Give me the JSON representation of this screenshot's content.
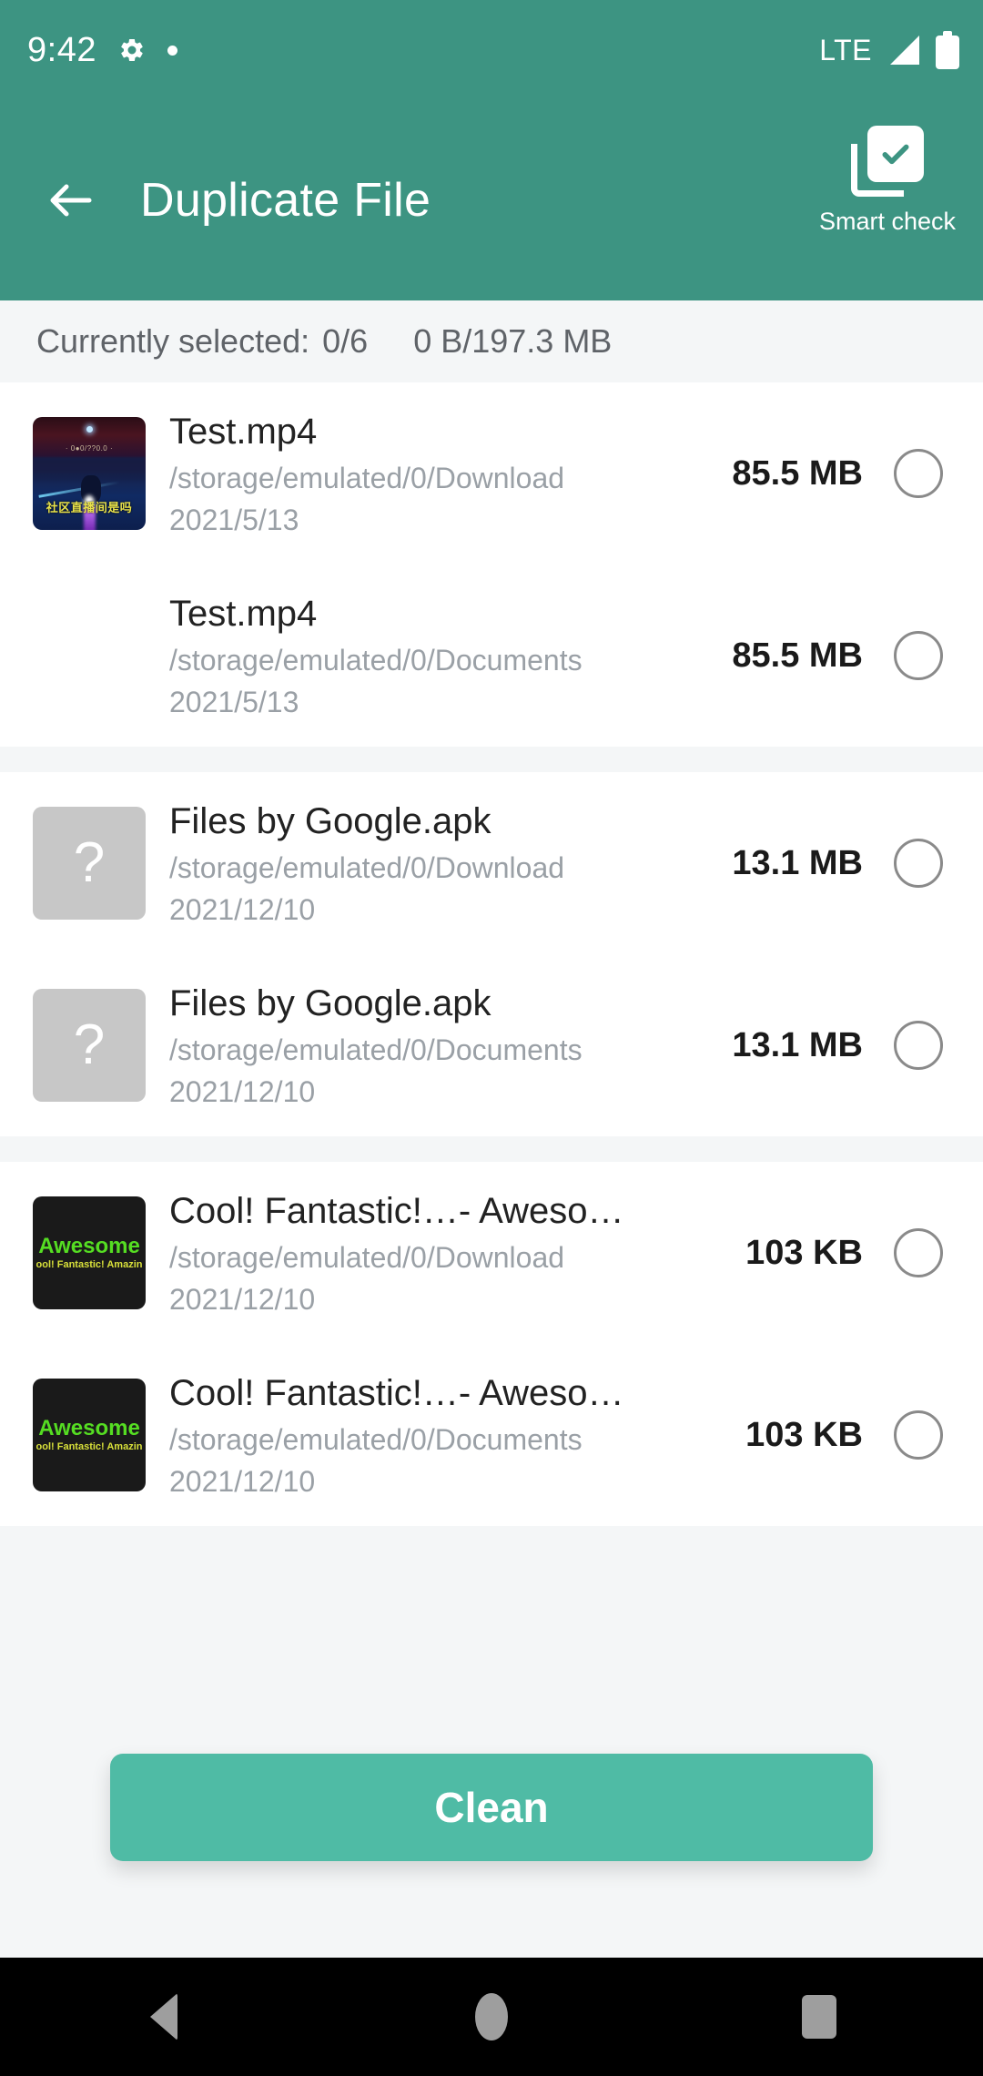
{
  "status_bar": {
    "time": "9:42",
    "gear_icon": "gear-icon",
    "dot_icon": "dot-indicator",
    "network": "LTE",
    "signal_icon": "signal-bar-icon",
    "battery_icon": "battery-icon"
  },
  "app_bar": {
    "back_icon": "back-arrow-icon",
    "title": "Duplicate File",
    "smart_check_label": "Smart check",
    "smart_check_icon": "checked-document-icon"
  },
  "selection_bar": {
    "label": "Currently selected:",
    "count": "0/6",
    "sizes": "0 B/197.3 MB"
  },
  "groups": [
    {
      "items": [
        {
          "name": "Test.mp4",
          "path": "/storage/emulated/0/Download",
          "date": "2021/5/13",
          "size": "85.5 MB",
          "thumb_type": "video",
          "thumb_caption": "社区直播间是吗",
          "thumb_mid_text": "· 0&#9679;0/??0.0 ·",
          "selected": false
        },
        {
          "name": "Test.mp4",
          "path": "/storage/emulated/0/Documents",
          "date": "2021/5/13",
          "size": "85.5 MB",
          "thumb_type": "none",
          "selected": false
        }
      ]
    },
    {
      "items": [
        {
          "name": "Files by Google.apk",
          "path": "/storage/emulated/0/Download",
          "date": "2021/12/10",
          "size": "13.1 MB",
          "thumb_type": "unknown",
          "thumb_glyph": "?",
          "selected": false
        },
        {
          "name": "Files by Google.apk",
          "path": "/storage/emulated/0/Documents",
          "date": "2021/12/10",
          "size": "13.1 MB",
          "thumb_type": "unknown",
          "thumb_glyph": "?",
          "selected": false
        }
      ]
    },
    {
      "items": [
        {
          "name": "Cool! Fantastic!…- Awesome.png",
          "path": "/storage/emulated/0/Download",
          "date": "2021/12/10",
          "size": "103 KB",
          "thumb_type": "image",
          "thumb_title": "Awesome",
          "thumb_subtitle": "ool! Fantastic! Amazin",
          "selected": false
        },
        {
          "name": "Cool! Fantastic!…- Awesome.png",
          "path": "/storage/emulated/0/Documents",
          "date": "2021/12/10",
          "size": "103 KB",
          "thumb_type": "image",
          "thumb_title": "Awesome",
          "thumb_subtitle": "ool! Fantastic! Amazin",
          "selected": false
        }
      ]
    }
  ],
  "action": {
    "clean_label": "Clean"
  },
  "nav_bar": {
    "back_icon": "nav-back-icon",
    "home_icon": "nav-home-icon",
    "recents_icon": "nav-recents-icon"
  },
  "colors": {
    "header_teal": "#3D9482",
    "button_teal": "#4FBBA5",
    "background_gray": "#F4F6F7",
    "text_primary": "#222222",
    "text_secondary": "#9AA0A6"
  }
}
